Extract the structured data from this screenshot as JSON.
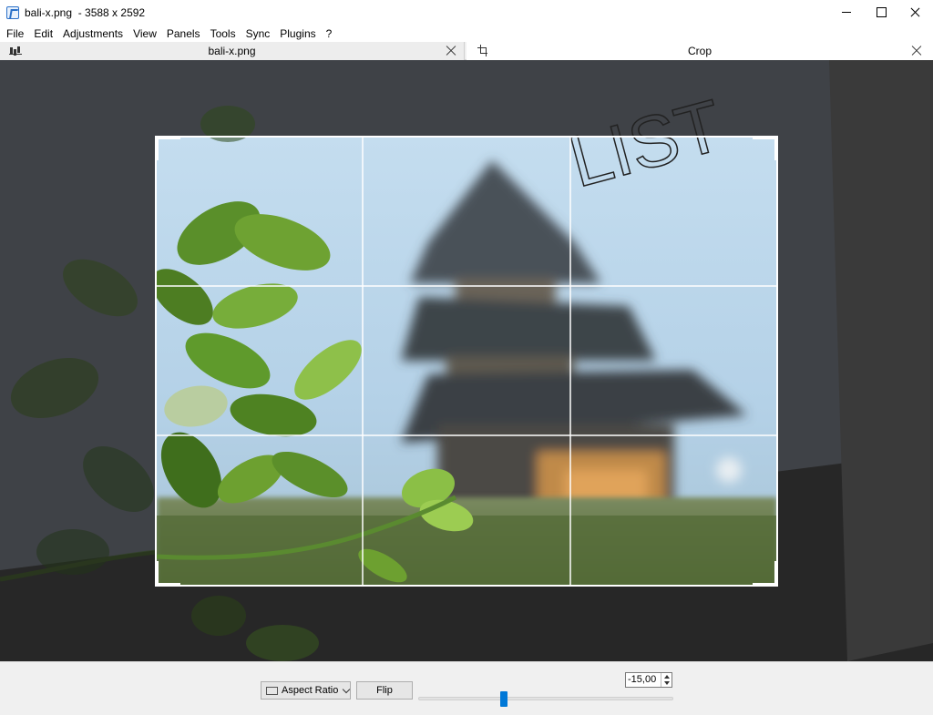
{
  "window": {
    "title": "bali-x.png  - 3588 x 2592"
  },
  "menu": {
    "items": [
      "File",
      "Edit",
      "Adjustments",
      "View",
      "Panels",
      "Tools",
      "Sync",
      "Plugins",
      "?"
    ]
  },
  "panels": {
    "left_title": "bali-x.png",
    "right_title": "Crop"
  },
  "canvas": {
    "overlay_text": "LIST"
  },
  "toolbar": {
    "aspect_label": "Aspect Ratio",
    "flip_label": "Flip",
    "rotation_value": "-15,00",
    "rotation_slider_fraction": 0.335
  },
  "colors": {
    "accent": "#0078d7",
    "sky": "#bcd8ec",
    "leaf": "#5b8f2a"
  }
}
